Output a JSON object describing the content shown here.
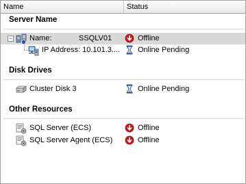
{
  "header": {
    "col_name": "Name",
    "col_status": "Status"
  },
  "sections": {
    "server_name": "Server Name",
    "disk_drives": "Disk Drives",
    "other_resources": "Other Resources"
  },
  "server": {
    "name_label": "Name:",
    "name_value": "SSQLV01",
    "name_status": "Offline",
    "ip_label": "IP Address: 10.101.3....",
    "ip_status": "Online Pending"
  },
  "disk": {
    "label": "Cluster Disk 3",
    "status": "Online Pending"
  },
  "resources": [
    {
      "label": "SQL Server (ECS)",
      "status": "Offline"
    },
    {
      "label": "SQL Server Agent (ECS)",
      "status": "Offline"
    }
  ],
  "colors": {
    "offline": "#c81e1e",
    "pending": "#1f4ea8",
    "selection": "#d9d9d9"
  }
}
